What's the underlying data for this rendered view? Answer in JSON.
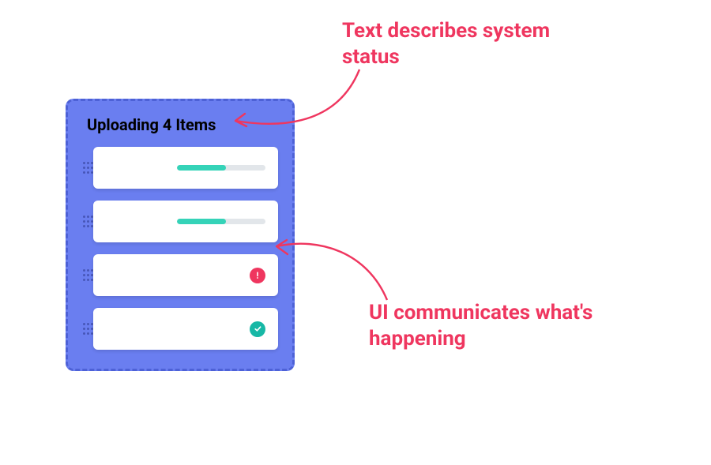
{
  "panel": {
    "title": "Uploading 4 Items",
    "items": [
      {
        "type": "progress",
        "percent": 55
      },
      {
        "type": "progress",
        "percent": 55
      },
      {
        "type": "error"
      },
      {
        "type": "success"
      }
    ]
  },
  "annotations": {
    "top": "Text describes system status",
    "bottom": "UI communicates what's happening"
  },
  "colors": {
    "panel_bg": "#6a7ef0",
    "panel_border": "#4d61d6",
    "progress_fill": "#35d3b8",
    "progress_track": "#e2e6ea",
    "error": "#ef365f",
    "success": "#17b8a6",
    "annotation": "#ef365f"
  }
}
